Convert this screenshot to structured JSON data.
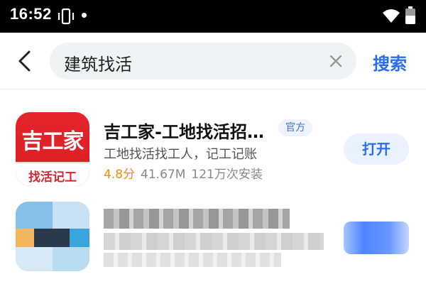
{
  "status_bar": {
    "time": "16:52",
    "icons": [
      "vibrate-icon",
      "notification-dot-icon",
      "wifi-icon",
      "battery-icon"
    ]
  },
  "search_bar": {
    "back_icon": "chevron-left-icon",
    "query": "建筑找活",
    "clear_icon": "close-icon",
    "action_label": "搜索"
  },
  "result": {
    "icon_brand_text": "吉工家",
    "icon_slogan_text": "找活记工",
    "title": "吉工家-工地找活招…",
    "badge": "官方",
    "description": "工地找活找工人，记工记账",
    "rating": "4.8分",
    "size": "41.67M",
    "installs": "121万次安装",
    "button_label": "打开"
  },
  "colors": {
    "accent": "#2b6df0",
    "rating": "#f28c00",
    "brand_red": "#e4252b",
    "status_bar": "#000000"
  }
}
